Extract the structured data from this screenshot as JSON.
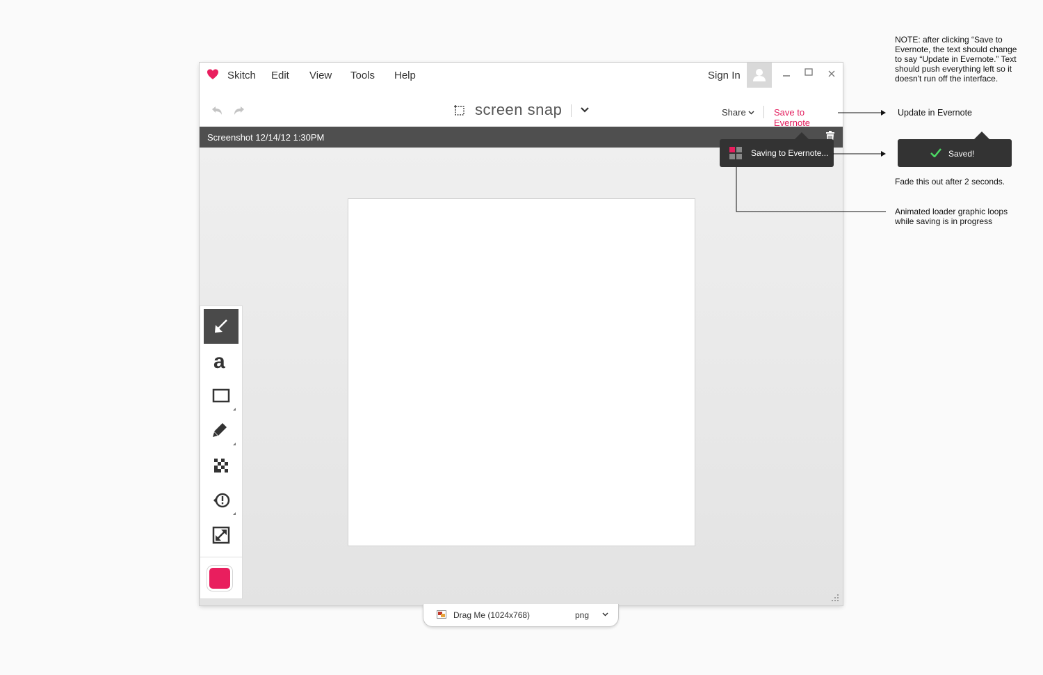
{
  "app": {
    "name": "Skitch"
  },
  "menu": [
    "Edit",
    "View",
    "Tools",
    "Help"
  ],
  "account": {
    "sign_in": "Sign In"
  },
  "toolbar": {
    "snap_title": "screen snap",
    "share_label": "Share",
    "save_label": "Save to Evernote"
  },
  "document": {
    "title": "Screenshot 12/14/12 1:30PM"
  },
  "saving_popup": {
    "text": "Saving to Evernote..."
  },
  "tools": [
    "arrow-tool",
    "text-tool",
    "rectangle-tool",
    "pen-tool",
    "pixelate-tool",
    "stamp-tool",
    "crop-resize-tool"
  ],
  "color_swatch": "#e91e5e",
  "drag_tab": {
    "label": "Drag Me (1024x768)",
    "format": "png"
  },
  "annotations": {
    "note": "NOTE: after clicking “Save to Evernote, the text should change to say “Update in Evernote.” Text should push everything left so it doesn't run off the interface.",
    "update_label": "Update in Evernote",
    "saved_text": "Saved!",
    "fade_note": "Fade this out after 2 seconds.",
    "loader_note": "Animated loader graphic loops while saving is in progress"
  },
  "colors": {
    "accent": "#e31d5d",
    "titlebar": "#4f4f4f",
    "popup": "#333333"
  }
}
